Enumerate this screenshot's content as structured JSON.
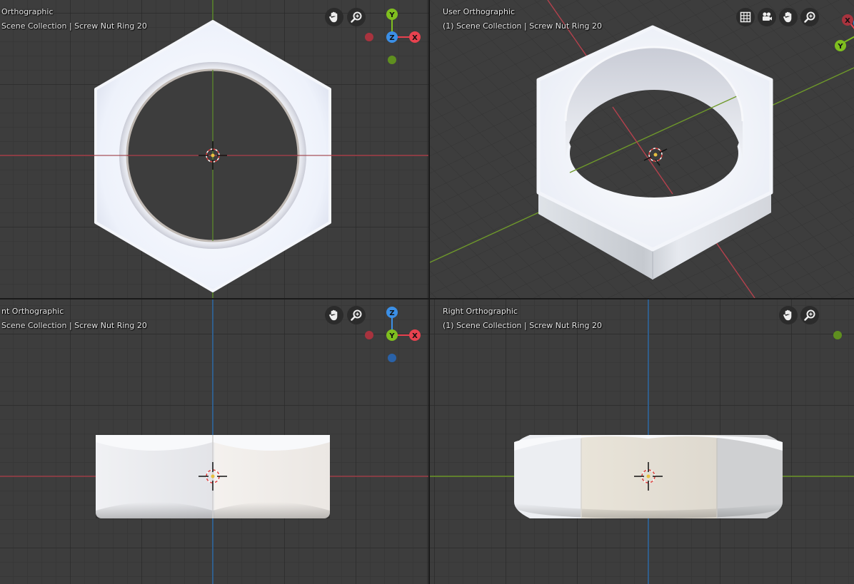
{
  "viewports": {
    "top": {
      "title": "Orthographic",
      "collection": "Scene Collection | Screw Nut Ring 20"
    },
    "user": {
      "title": "User Orthographic",
      "collection": "(1) Scene Collection | Screw Nut Ring 20"
    },
    "front": {
      "title": "nt Orthographic",
      "collection": "Scene Collection | Screw Nut Ring 20"
    },
    "right": {
      "title": "Right Orthographic",
      "collection": "(1) Scene Collection | Screw Nut Ring 20"
    }
  },
  "gizmo_labels": {
    "x": "X",
    "y": "Y",
    "z": "Z"
  },
  "colors": {
    "x_axis": "#e8424f",
    "y_axis": "#7fbf1f",
    "z_axis": "#3b8fe6",
    "grid_bg": "#3d3d3d",
    "x_axis_line": "#b5414d",
    "y_axis_line": "#6f9a2a",
    "z_axis_line": "#2f6fb0",
    "object": "#e8ecf4"
  },
  "icons": [
    "hand-pan-icon",
    "zoom-icon",
    "grid-toggle-icon",
    "camera-icon",
    "3d-cursor-icon"
  ]
}
